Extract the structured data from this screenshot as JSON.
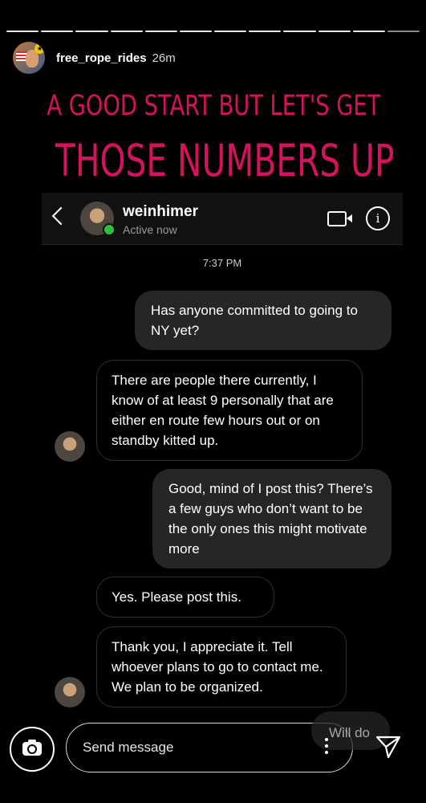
{
  "story": {
    "username": "free_rope_rides",
    "time_ago": "26m",
    "caption_line1": "A GOOD START BUT LET'S GET",
    "caption_line2": "THOSE NUMBERS UP",
    "caption_color": "#d4125f"
  },
  "dm": {
    "contact_name": "weinhimer",
    "contact_status": "Active now",
    "info_glyph": "i",
    "timestamp": "7:37 PM",
    "messages": [
      {
        "side": "out",
        "text": "Has anyone committed to going to NY yet?"
      },
      {
        "side": "in",
        "text": "There are people there currently, I know of at least 9 personally that are either en route few hours out or on standby kitted up."
      },
      {
        "side": "out",
        "text": "Good, mind of I post this? There’s a few guys who don’t want to be the only ones this might motivate more"
      },
      {
        "side": "in",
        "text": "Yes. Please post this."
      },
      {
        "side": "in",
        "text": "Thank you, I appreciate it. Tell whoever plans to go to contact me. We plan to be organized."
      },
      {
        "side": "out",
        "text": "Will do"
      }
    ]
  },
  "reply_bar": {
    "placeholder": "Send message"
  },
  "icons": [
    "back-icon",
    "video-call-icon",
    "info-icon",
    "camera-icon",
    "more-icon",
    "send-icon"
  ]
}
